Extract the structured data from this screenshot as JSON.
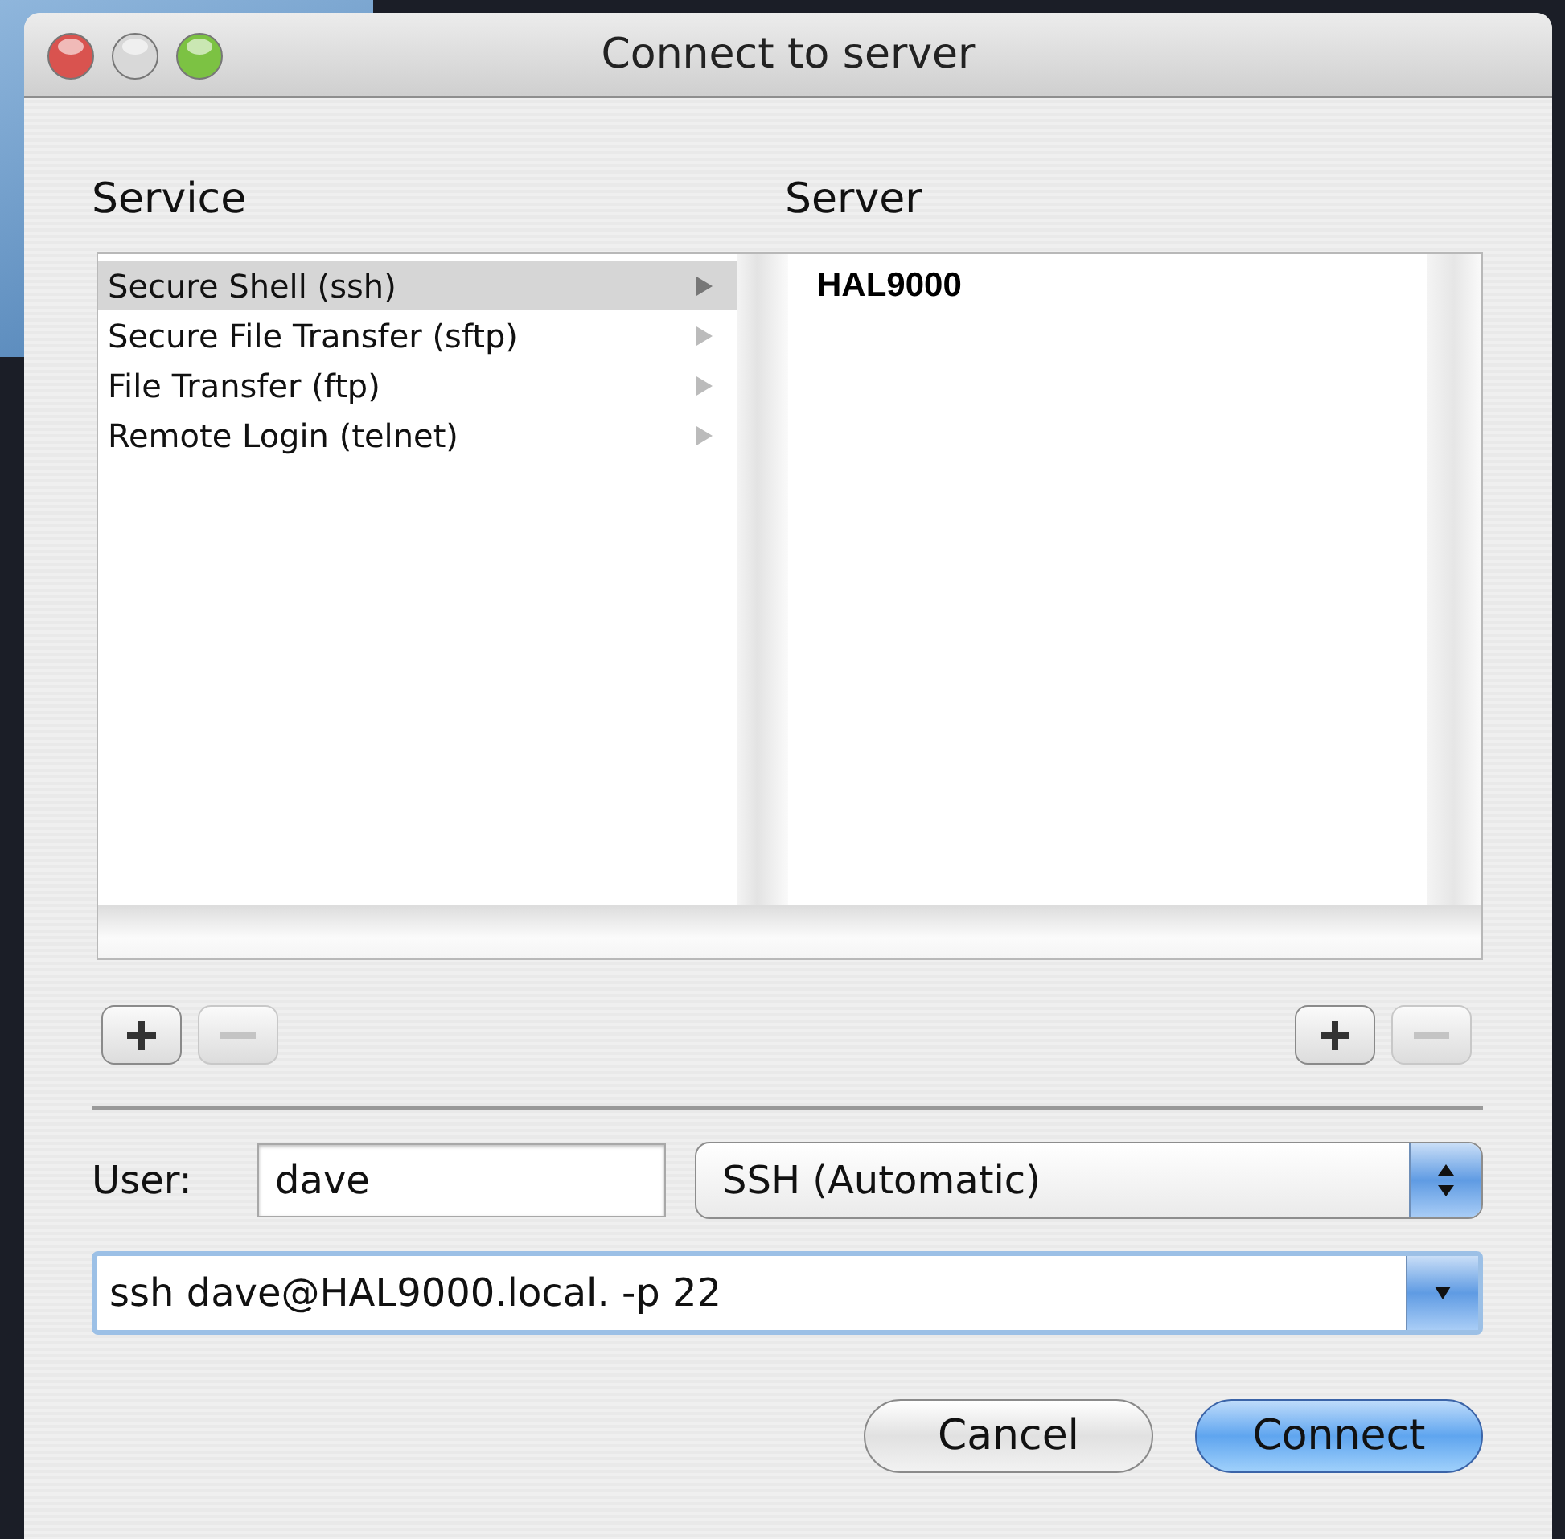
{
  "window": {
    "title": "Connect to server"
  },
  "service": {
    "label": "Service",
    "items": [
      {
        "label": "Secure Shell (ssh)",
        "selected": true
      },
      {
        "label": "Secure File Transfer (sftp)",
        "selected": false
      },
      {
        "label": "File Transfer (ftp)",
        "selected": false
      },
      {
        "label": "Remote Login (telnet)",
        "selected": false
      }
    ]
  },
  "server": {
    "label": "Server",
    "items": [
      {
        "label": "HAL9000",
        "selected": false
      }
    ]
  },
  "service_buttons": [
    {
      "kind": "add",
      "disabled": false
    },
    {
      "kind": "remove",
      "disabled": true
    }
  ],
  "server_buttons": [
    {
      "kind": "add",
      "disabled": false
    },
    {
      "kind": "remove",
      "disabled": true
    }
  ],
  "user": {
    "label": "User:",
    "value": "dave"
  },
  "protocol": {
    "value": "SSH (Automatic)"
  },
  "command": {
    "value": "ssh dave@HAL9000.local. -p 22"
  },
  "buttons": [
    {
      "label": "Cancel",
      "default": false
    },
    {
      "label": "Connect",
      "default": true
    }
  ]
}
